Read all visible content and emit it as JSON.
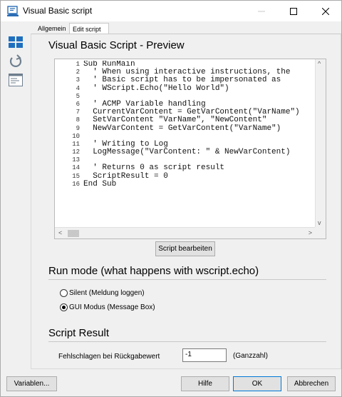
{
  "window": {
    "title": "Visual Basic script"
  },
  "tabs": [
    {
      "label": "Allgemein"
    },
    {
      "label": "Edit script"
    }
  ],
  "preview": {
    "title": "Visual Basic Script - Preview",
    "lines": [
      {
        "n": "1",
        "text": "Sub RunMain"
      },
      {
        "n": "2",
        "text": "  ' When using interactive instructions, the"
      },
      {
        "n": "3",
        "text": "  ' Basic script has to be impersonated as"
      },
      {
        "n": "4",
        "text": "  ' WScript.Echo(\"Hello World\")"
      },
      {
        "n": "5",
        "text": ""
      },
      {
        "n": "6",
        "text": "  ' ACMP Variable handling"
      },
      {
        "n": "7",
        "text": "  CurrentVarContent = GetVarContent(\"VarName\")"
      },
      {
        "n": "8",
        "text": "  SetVarContent \"VarName\", \"NewContent\""
      },
      {
        "n": "9",
        "text": "  NewVarContent = GetVarContent(\"VarName\")"
      },
      {
        "n": "10",
        "text": ""
      },
      {
        "n": "11",
        "text": "  ' Writing to Log"
      },
      {
        "n": "12",
        "text": "  LogMessage(\"VarContent: \" & NewVarContent)"
      },
      {
        "n": "13",
        "text": ""
      },
      {
        "n": "14",
        "text": "  ' Returns 0 as script result"
      },
      {
        "n": "15",
        "text": "  ScriptResult = 0"
      },
      {
        "n": "16",
        "text": "End Sub"
      }
    ],
    "edit_button": "Script bearbeiten"
  },
  "run_mode": {
    "title": "Run mode (what happens with wscript.echo)",
    "options": [
      {
        "label": "Silent (Meldung loggen)",
        "checked": false
      },
      {
        "label": "GUI Modus (Message Box)",
        "checked": true
      }
    ]
  },
  "script_result": {
    "title": "Script Result",
    "label": "Fehlschlagen bei Rückgabewert",
    "value": "-1",
    "unit": "(Ganzzahl)"
  },
  "footer": {
    "variables_button": "Variablen...",
    "help_button": "Hilfe",
    "ok_button": "OK",
    "cancel_button": "Abbrechen"
  },
  "sidebar": {
    "icons": [
      "tiles-icon",
      "undo-icon",
      "script-window-icon"
    ]
  },
  "colors": {
    "accent": "#0078d7",
    "sidebar_icon": "#1f6fbf"
  }
}
